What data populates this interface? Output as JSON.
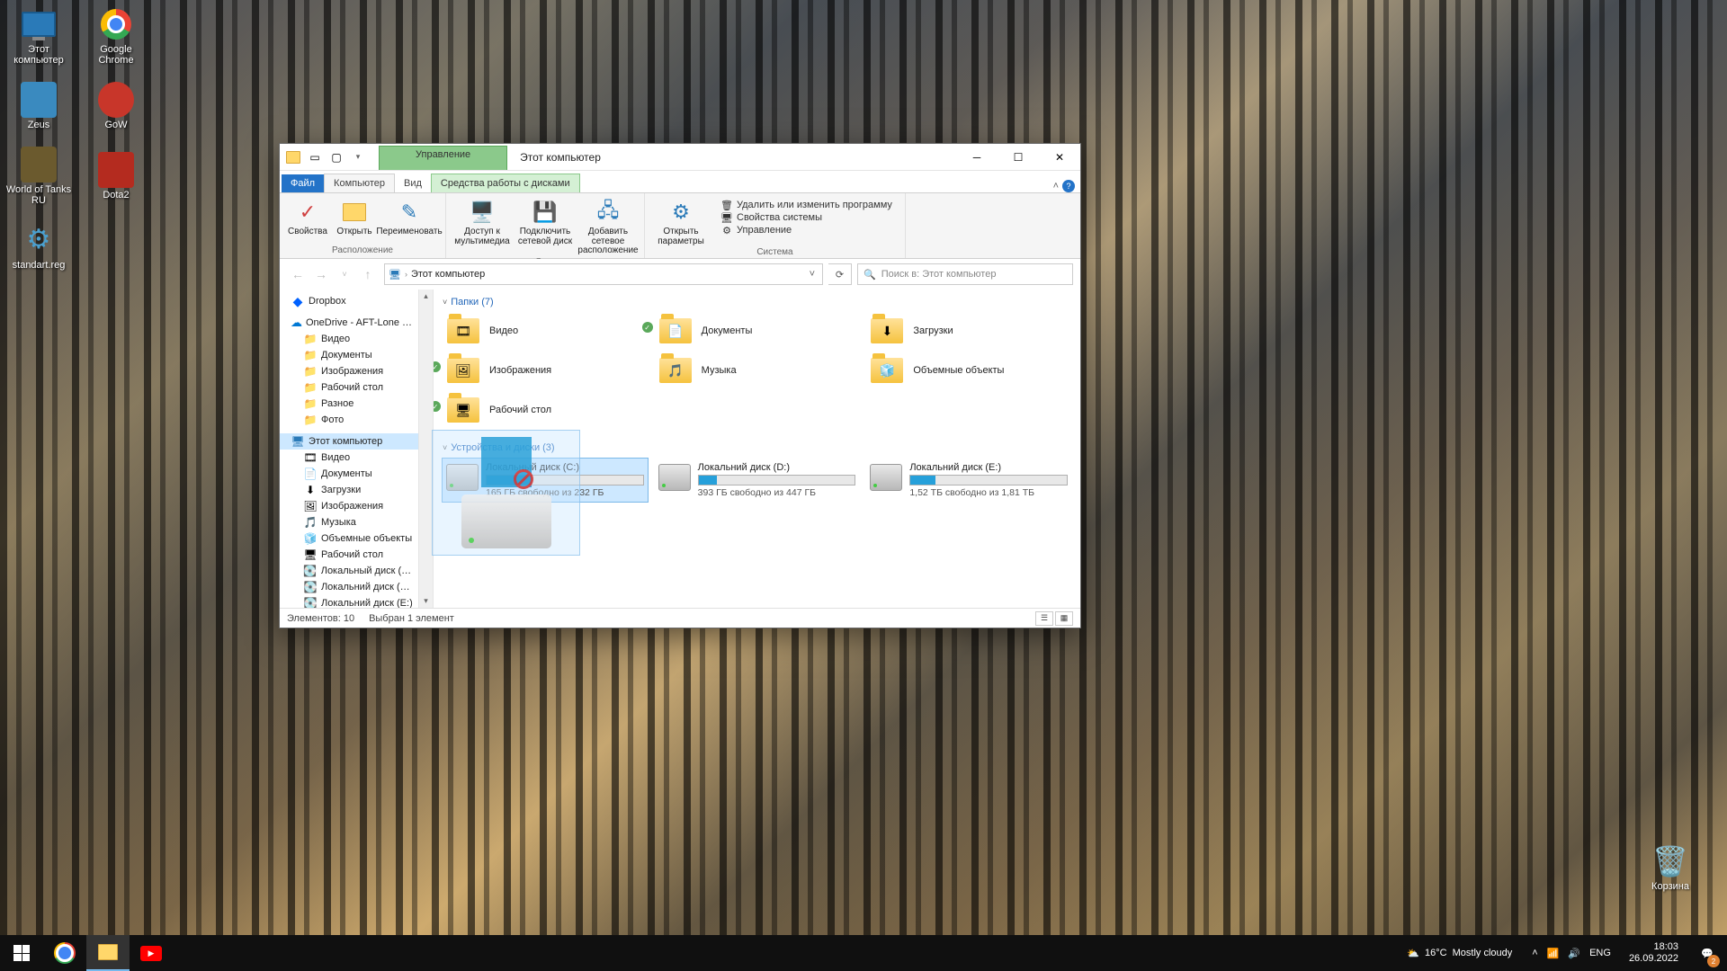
{
  "desktop": {
    "icons": [
      {
        "label": "Этот компьютер",
        "color": "#2a7ab8"
      },
      {
        "label": "Google Chrome",
        "color": "#ea4335"
      },
      {
        "label": "Zeus",
        "color": "#3a8abf"
      },
      {
        "label": "GoW",
        "color": "#c8362a"
      },
      {
        "label": "World of Tanks RU",
        "color": "#6b5a2e"
      },
      {
        "label": "Dota2",
        "color": "#b42b1f"
      },
      {
        "label": "standart.reg",
        "color": "#4aa0d0"
      }
    ],
    "recycle": "Корзина"
  },
  "window": {
    "context_tab": "Управление",
    "title": "Этот компьютер",
    "tabs": {
      "file": "Файл",
      "computer": "Компьютер",
      "view": "Вид",
      "drive_tools": "Средства работы с дисками"
    },
    "ribbon": {
      "location": {
        "label": "Расположение",
        "items": {
          "properties": "Свойства",
          "open": "Открыть",
          "rename": "Переименовать"
        }
      },
      "network": {
        "label": "Сеть",
        "items": {
          "media": "Доступ к мультимедиа",
          "map": "Подключить сетевой диск",
          "add": "Добавить сетевое расположение"
        }
      },
      "system": {
        "label": "Система",
        "open_settings": "Открыть параметры",
        "uninstall": "Удалить или изменить программу",
        "sys_props": "Свойства системы",
        "manage": "Управление"
      }
    },
    "address": {
      "crumb": "Этот компьютер"
    },
    "search_placeholder": "Поиск в: Этот компьютер",
    "sidebar": {
      "dropbox": "Dropbox",
      "onedrive": "OneDrive - AFT-Lone Star Colle",
      "od_items": [
        "Видео",
        "Документы",
        "Изображения",
        "Рабочий стол",
        "Разное",
        "Фото"
      ],
      "thispc": "Этот компьютер",
      "pc_items": [
        "Видео",
        "Документы",
        "Загрузки",
        "Изображения",
        "Музыка",
        "Объемные объекты",
        "Рабочий стол",
        "Локальный диск (C:)",
        "Локальний диск (D:)",
        "Локальний диск (E:)"
      ]
    },
    "content": {
      "folders_header": "Папки (7)",
      "folders": [
        {
          "name": "Видео",
          "sync": false
        },
        {
          "name": "Документы",
          "sync": true
        },
        {
          "name": "Загрузки",
          "sync": false
        },
        {
          "name": "Изображения",
          "sync": true
        },
        {
          "name": "Музыка",
          "sync": false
        },
        {
          "name": "Объемные объекты",
          "sync": false
        },
        {
          "name": "Рабочий стол",
          "sync": true
        }
      ],
      "drives_header": "Устройства и диски (3)",
      "drives": [
        {
          "name": "Локальный диск (C:)",
          "free": "165 ГБ свободно из 232 ГБ",
          "pct": 29,
          "selected": true
        },
        {
          "name": "Локальний диск (D:)",
          "free": "393 ГБ свободно из 447 ГБ",
          "pct": 12
        },
        {
          "name": "Локальний диск (E:)",
          "free": "1,52 ТБ свободно из 1,81 ТБ",
          "pct": 16
        }
      ]
    },
    "status": {
      "items": "Элементов: 10",
      "selected": "Выбран 1 элемент"
    }
  },
  "taskbar": {
    "weather": {
      "temp": "16°C",
      "desc": "Mostly cloudy"
    },
    "lang": "ENG",
    "time": "18:03",
    "date": "26.09.2022",
    "notif_count": "2"
  }
}
